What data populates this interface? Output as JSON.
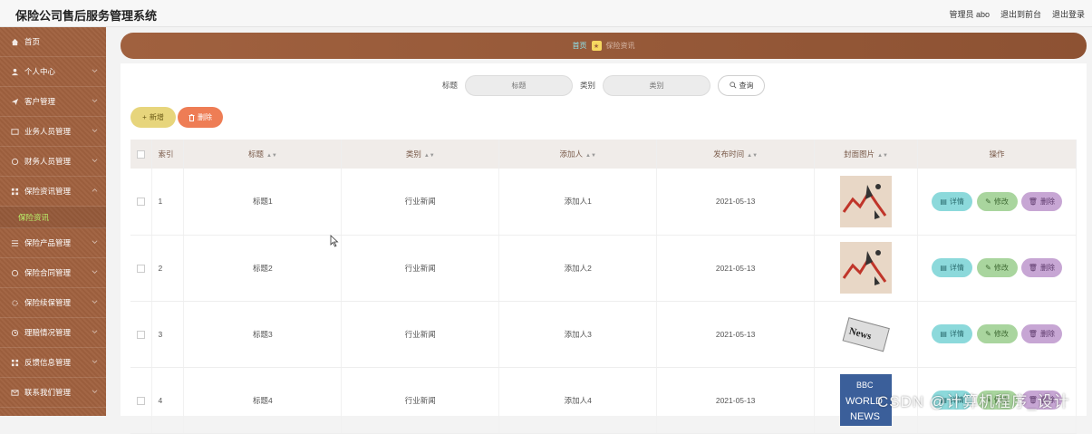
{
  "app": {
    "title": "保险公司售后服务管理系统",
    "links": [
      "管理员 abo",
      "退出到前台",
      "退出登录"
    ]
  },
  "sidebar": {
    "items": [
      {
        "label": "首页",
        "icon": "home-icon"
      },
      {
        "label": "个人中心",
        "icon": "user-icon"
      },
      {
        "label": "客户管理",
        "icon": "send-icon"
      },
      {
        "label": "业务人员管理",
        "icon": "list-icon"
      },
      {
        "label": "财务人员管理",
        "icon": "clock-icon"
      },
      {
        "label": "保险资讯管理",
        "icon": "grid-icon"
      },
      {
        "label": "保险产品管理",
        "icon": "list-icon"
      },
      {
        "label": "保险合同管理",
        "icon": "doc-icon"
      },
      {
        "label": "保险续保管理",
        "icon": "gear-icon"
      },
      {
        "label": "理赔情况管理",
        "icon": "clock-icon"
      },
      {
        "label": "反馈信息管理",
        "icon": "grid-icon"
      },
      {
        "label": "联系我们管理",
        "icon": "mail-icon"
      }
    ],
    "sub_item": "保险资讯"
  },
  "breadcrumb": {
    "home": "首页",
    "current": "保险资讯"
  },
  "search": {
    "title_label": "标题",
    "title_placeholder": "标题",
    "category_label": "类别",
    "category_placeholder": "类别",
    "query_button": "查询"
  },
  "toolbar": {
    "add_label": "新增",
    "delete_label": "删除"
  },
  "table": {
    "headers": [
      "索引",
      "标题",
      "类别",
      "添加人",
      "发布时间",
      "封面图片",
      "操作"
    ],
    "rows": [
      {
        "index": "1",
        "title": "标题1",
        "category": "行业新闻",
        "adder": "添加人1",
        "date": "2021-05-13",
        "image": "chart-arrow-image"
      },
      {
        "index": "2",
        "title": "标题2",
        "category": "行业新闻",
        "adder": "添加人2",
        "date": "2021-05-13",
        "image": "chart-arrow-image"
      },
      {
        "index": "3",
        "title": "标题3",
        "category": "行业新闻",
        "adder": "添加人3",
        "date": "2021-05-13",
        "image": "news-paper-image"
      },
      {
        "index": "4",
        "title": "标题4",
        "category": "行业新闻",
        "adder": "添加人4",
        "date": "2021-05-13",
        "image": "bbc-world-news-image"
      }
    ],
    "row_actions": {
      "detail": "详情",
      "edit": "修改",
      "delete": "删除"
    }
  },
  "watermark": "CSDN @计算机程序_设计"
}
